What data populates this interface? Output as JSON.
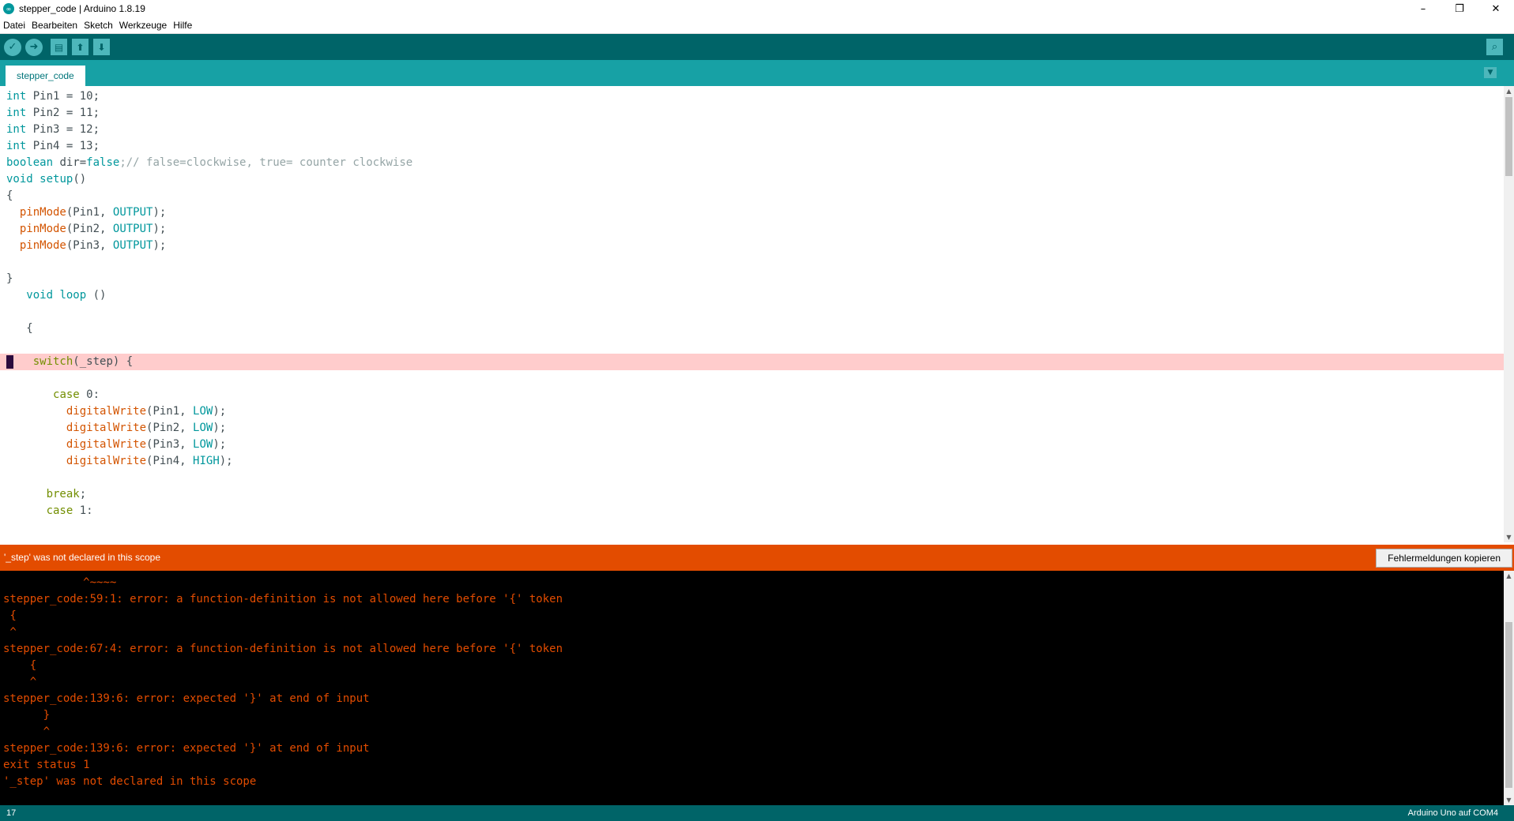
{
  "window": {
    "title": "stepper_code | Arduino 1.8.19",
    "icon_text": "∞",
    "minimize": "–",
    "maximize": "❐",
    "close": "✕"
  },
  "menu": [
    "Datei",
    "Bearbeiten",
    "Sketch",
    "Werkzeuge",
    "Hilfe"
  ],
  "toolbar": {
    "buttons": [
      {
        "name": "verify",
        "icon": "check-icon",
        "glyph": "✓"
      },
      {
        "name": "upload",
        "icon": "arrow-right-icon",
        "glyph": "➜"
      },
      {
        "name": "new",
        "icon": "new-file-icon",
        "glyph": "▤"
      },
      {
        "name": "open",
        "icon": "arrow-up-icon",
        "glyph": "⬆"
      },
      {
        "name": "save",
        "icon": "arrow-down-icon",
        "glyph": "⬇"
      }
    ],
    "serial_monitor_glyph": "⌕"
  },
  "tabs": [
    {
      "label": "stepper_code"
    }
  ],
  "tab_menu_glyph": "▼",
  "editor": {
    "lines": [
      [
        {
          "t": "int",
          "c": "kw"
        },
        {
          "t": " Pin1 = 10;"
        }
      ],
      [
        {
          "t": "int",
          "c": "kw"
        },
        {
          "t": " Pin2 = 11;"
        }
      ],
      [
        {
          "t": "int",
          "c": "kw"
        },
        {
          "t": " Pin3 = 12;"
        }
      ],
      [
        {
          "t": "int",
          "c": "kw"
        },
        {
          "t": " Pin4 = 13;"
        }
      ],
      [
        {
          "t": "boolean",
          "c": "kw"
        },
        {
          "t": " dir="
        },
        {
          "t": "false",
          "c": "kw"
        },
        {
          "t": ";// false=clockwise, true= counter clockwise",
          "c": "cm"
        }
      ],
      [
        {
          "t": "void",
          "c": "kw"
        },
        {
          "t": " "
        },
        {
          "t": "setup",
          "c": "kw"
        },
        {
          "t": "()"
        }
      ],
      [
        {
          "t": "{"
        }
      ],
      [
        {
          "t": "  "
        },
        {
          "t": "pinMode",
          "c": "fn"
        },
        {
          "t": "(Pin1, "
        },
        {
          "t": "OUTPUT",
          "c": "ct"
        },
        {
          "t": ");"
        }
      ],
      [
        {
          "t": "  "
        },
        {
          "t": "pinMode",
          "c": "fn"
        },
        {
          "t": "(Pin2, "
        },
        {
          "t": "OUTPUT",
          "c": "ct"
        },
        {
          "t": ");"
        }
      ],
      [
        {
          "t": "  "
        },
        {
          "t": "pinMode",
          "c": "fn"
        },
        {
          "t": "(Pin3, "
        },
        {
          "t": "OUTPUT",
          "c": "ct"
        },
        {
          "t": ");"
        }
      ],
      [
        {
          "t": ""
        }
      ],
      [
        {
          "t": "}"
        }
      ],
      [
        {
          "t": "   "
        },
        {
          "t": "void",
          "c": "kw"
        },
        {
          "t": " "
        },
        {
          "t": "loop",
          "c": "kw"
        },
        {
          "t": " ()"
        }
      ],
      [
        {
          "t": ""
        }
      ],
      [
        {
          "t": "   {"
        }
      ],
      [
        {
          "t": ""
        }
      ],
      [
        {
          "t": "    "
        },
        {
          "t": "switch",
          "c": "ctrl"
        },
        {
          "t": "(_step) {"
        }
      ],
      [
        {
          "t": ""
        }
      ],
      [
        {
          "t": "       "
        },
        {
          "t": "case",
          "c": "ctrl"
        },
        {
          "t": " 0:"
        }
      ],
      [
        {
          "t": "         "
        },
        {
          "t": "digitalWrite",
          "c": "fn"
        },
        {
          "t": "(Pin1, "
        },
        {
          "t": "LOW",
          "c": "ct"
        },
        {
          "t": ");"
        }
      ],
      [
        {
          "t": "         "
        },
        {
          "t": "digitalWrite",
          "c": "fn"
        },
        {
          "t": "(Pin2, "
        },
        {
          "t": "LOW",
          "c": "ct"
        },
        {
          "t": ");"
        }
      ],
      [
        {
          "t": "         "
        },
        {
          "t": "digitalWrite",
          "c": "fn"
        },
        {
          "t": "(Pin3, "
        },
        {
          "t": "LOW",
          "c": "ct"
        },
        {
          "t": ");"
        }
      ],
      [
        {
          "t": "         "
        },
        {
          "t": "digitalWrite",
          "c": "fn"
        },
        {
          "t": "(Pin4, "
        },
        {
          "t": "HIGH",
          "c": "ct"
        },
        {
          "t": ");"
        }
      ],
      [
        {
          "t": ""
        }
      ],
      [
        {
          "t": "      "
        },
        {
          "t": "break",
          "c": "ctrl"
        },
        {
          "t": ";"
        }
      ],
      [
        {
          "t": "      "
        },
        {
          "t": "case",
          "c": "ctrl"
        },
        {
          "t": " 1:"
        }
      ],
      [
        {
          "t": ""
        }
      ]
    ],
    "error_line_index": 16
  },
  "error_bar": {
    "message": "'_step' was not declared in this scope",
    "copy_button": "Fehlermeldungen kopieren"
  },
  "console": {
    "lines": [
      "            ^~~~~",
      "stepper_code:59:1: error: a function-definition is not allowed here before '{' token",
      " {",
      " ^",
      "stepper_code:67:4: error: a function-definition is not allowed here before '{' token",
      "    {",
      "    ^",
      "stepper_code:139:6: error: expected '}' at end of input",
      "      }",
      "      ^",
      "stepper_code:139:6: error: expected '}' at end of input",
      "exit status 1",
      "'_step' was not declared in this scope"
    ]
  },
  "status": {
    "line": "17",
    "board": "Arduino Uno auf COM4"
  }
}
